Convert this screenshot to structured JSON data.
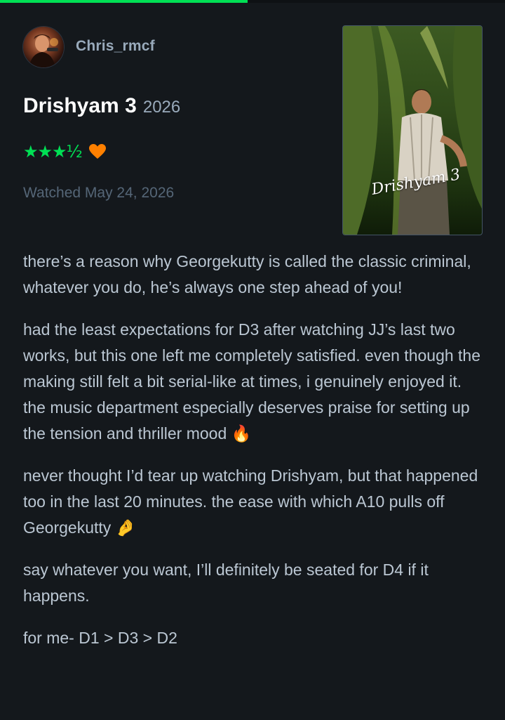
{
  "story_progress": {
    "fraction": 0.49
  },
  "reviewer": {
    "username": "Chris_rmcf",
    "avatar_icon": "user-avatar"
  },
  "film": {
    "title": "Drishyam 3",
    "year": "2026",
    "poster_title": "Drishyam 3"
  },
  "rating": {
    "stars_text": "★★★½",
    "value": 3.5,
    "liked": true,
    "like_icon": "heart-icon",
    "star_color": "#00e054",
    "heart_color": "#ff8000"
  },
  "watched_label": "Watched May 24, 2026",
  "review": {
    "paragraphs": [
      "there’s a reason why Georgekutty is called the classic criminal, whatever you do, he’s always one step ahead of you!",
      "had the least expectations for D3 after watching JJ’s last two works, but this one left me completely satisfied. even though the making still felt a bit serial-like at times, i genuinely enjoyed it. the music department especially deserves praise for setting up the tension and thriller mood 🔥",
      "never thought I’d tear up watching Drishyam, but that happened too in the last 20 minutes. the ease with which A10 pulls off Georgekutty 🤌",
      "say whatever you want, I’ll definitely be seated for D4 if it happens.",
      "for me- D1 > D3 > D2"
    ]
  },
  "colors": {
    "background": "#14181c",
    "accent_green": "#00e054",
    "text_primary": "#ffffff",
    "text_secondary": "#99aabb",
    "text_muted": "#556677"
  }
}
